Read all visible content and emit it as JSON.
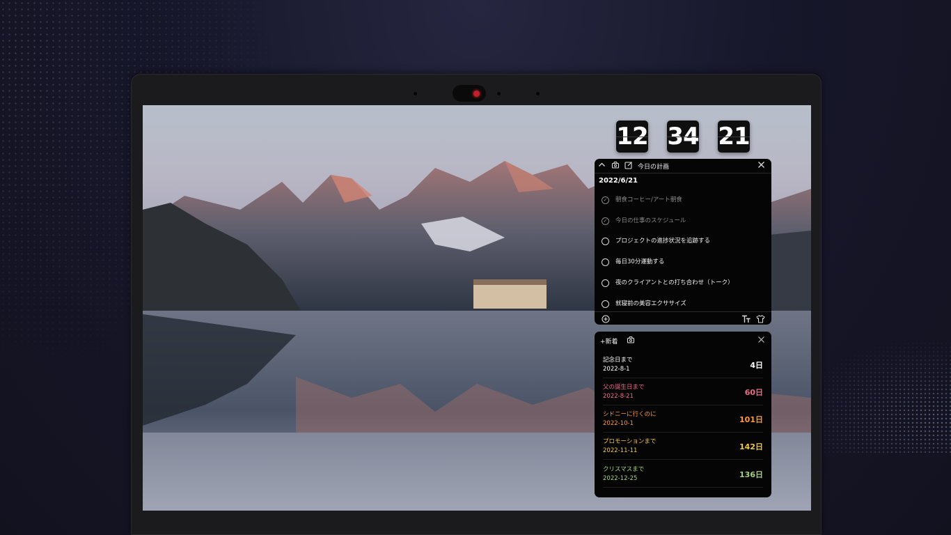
{
  "clock": {
    "hours": "12",
    "minutes": "34",
    "seconds": "21"
  },
  "todo": {
    "title": "今日の計画",
    "date": "2022/6/21",
    "tasks": [
      {
        "label": "朝食コーヒー/アート朝食",
        "done": true
      },
      {
        "label": "今日の仕事のスケジュール",
        "done": true
      },
      {
        "label": "プロジェクトの進捗状況を追跡する",
        "done": false
      },
      {
        "label": "毎日30分運動する",
        "done": false
      },
      {
        "label": "夜のクライアントとの打ち合わせ（トーク）",
        "done": false
      },
      {
        "label": "就寝前の美容エクササイズ",
        "done": false
      }
    ]
  },
  "countdown": {
    "new_label": "+新着",
    "items": [
      {
        "name": "記念日まで",
        "date": "2022-8-1",
        "days": "4日",
        "color": "#ffffff"
      },
      {
        "name": "父の誕生日まで",
        "date": "2022-8-21",
        "days": "60日",
        "color": "#f06a8a"
      },
      {
        "name": "シドニーに行くのに",
        "date": "2022-10-1",
        "days": "101日",
        "color": "#ff9b2f"
      },
      {
        "name": "プロモーションまで",
        "date": "2022-11-11",
        "days": "142日",
        "color": "#f2c541"
      },
      {
        "name": "クリスマスまで",
        "date": "2022-12-25",
        "days": "136日",
        "color": "#a8d184"
      }
    ]
  },
  "icons": {
    "collapse": "chevron-up-icon",
    "lock": "lock-icon",
    "edit": "edit-icon",
    "close": "close-icon",
    "add": "add-circle-icon",
    "text_size": "text-size-icon",
    "skin": "shirt-icon"
  }
}
